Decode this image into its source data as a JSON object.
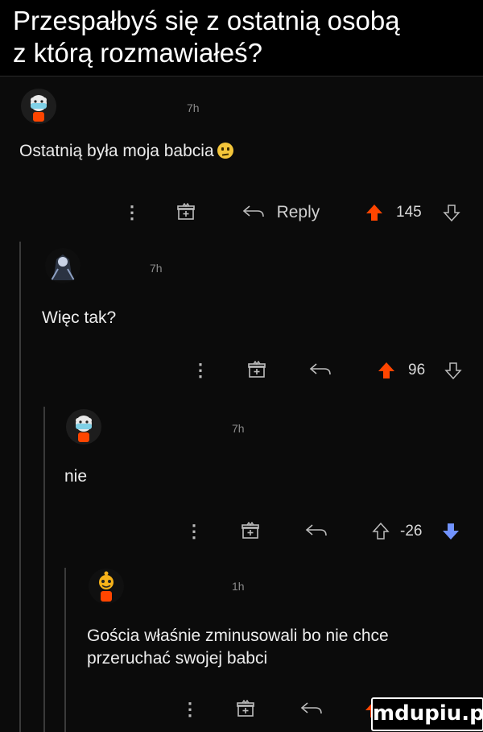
{
  "post": {
    "title_line1": "Przespałbyś się z ostatnią osobą",
    "title_line2": "z którą rozmawiałeś?"
  },
  "comments": [
    {
      "time": "7h",
      "text": "Ostatnią była moja babcia",
      "emoji": "confused-face",
      "reply_label": "Reply",
      "score": "145",
      "vote_state": "upvoted"
    },
    {
      "time": "7h",
      "text": "Więc tak?",
      "score": "96",
      "vote_state": "upvoted"
    },
    {
      "time": "7h",
      "text": "nie",
      "score": "-26",
      "vote_state": "downvoted"
    },
    {
      "time": "1h",
      "text": "Gościa właśnie zminusowali bo nie chce przeruchać swojej babci",
      "vote_state": "upvoted"
    }
  ],
  "watermark": "mdupiu.pl",
  "colors": {
    "upvote": "#ff4500",
    "downvote": "#7193ff",
    "background": "#0b0b0b",
    "thread_line": "#3a3a3a"
  },
  "icons": [
    "more-dots-icon",
    "award-icon",
    "reply-arrow-icon",
    "upvote-arrow-icon",
    "downvote-arrow-icon"
  ]
}
